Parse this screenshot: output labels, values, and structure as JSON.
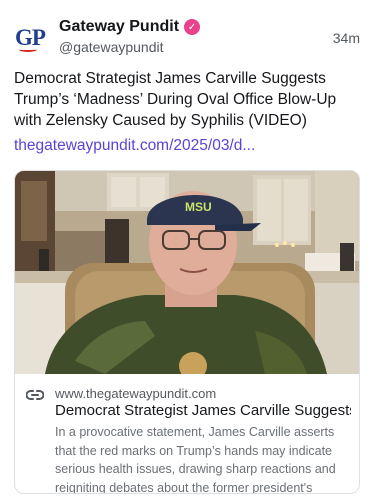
{
  "post": {
    "author": {
      "display_name": "Gateway Pundit",
      "handle": "@gatewaypundit",
      "avatar_text": "GP",
      "verified_icon": "verified-badge-icon"
    },
    "time": "34m",
    "text": "Democrat Strategist James Carville Suggests Trump’s ‘Madness’ During Oval Office Blow-Up with Zelensky Caused by Syphilis (VIDEO)",
    "link": "thegatewaypundit.com/2025/03/d..."
  },
  "card": {
    "image_alt": "",
    "domain": "www.thegatewaypundit.com",
    "title": "Democrat Strategist James Carville Suggests ...",
    "description": "In a provocative statement, James Carville asserts that the red marks on Trump’s hands may indicate serious health issues, drawing sharp reactions and reigniting debates about the former president's fitness."
  },
  "colors": {
    "link": "#5a43d6",
    "verified": "#e8428a",
    "secondary_text": "#54595f",
    "border": "#dcdfe3"
  }
}
